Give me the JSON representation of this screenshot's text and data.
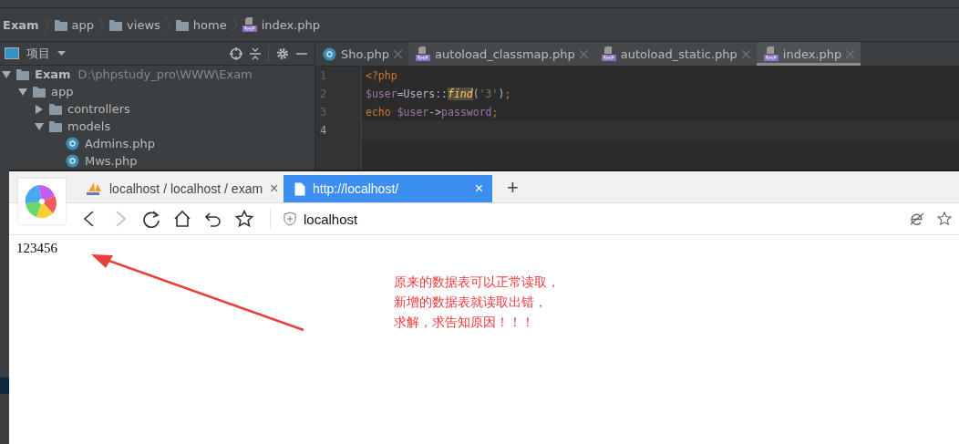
{
  "breadcrumb": [
    {
      "label": "Exam",
      "kind": "project"
    },
    {
      "label": "app",
      "kind": "folder"
    },
    {
      "label": "views",
      "kind": "folder"
    },
    {
      "label": "home",
      "kind": "folder"
    },
    {
      "label": "index.php",
      "kind": "php"
    }
  ],
  "project_panel": {
    "title": "项目",
    "tree": [
      {
        "label": "Exam",
        "kind": "folder",
        "path": "D:\\phpstudy_pro\\WWW\\Exam",
        "expanded": true,
        "children": [
          {
            "label": "app",
            "kind": "folder",
            "expanded": true,
            "children": [
              {
                "label": "controllers",
                "kind": "folder",
                "expanded": false
              },
              {
                "label": "models",
                "kind": "folder",
                "expanded": true,
                "children": [
                  {
                    "label": "Admins.php",
                    "kind": "class"
                  },
                  {
                    "label": "Mws.php",
                    "kind": "class"
                  }
                ]
              }
            ]
          }
        ]
      }
    ]
  },
  "editor_tabs": [
    {
      "label": "Sho.php",
      "kind": "class",
      "selected": false
    },
    {
      "label": "autoload_classmap.php",
      "kind": "php",
      "selected": false
    },
    {
      "label": "autoload_static.php",
      "kind": "php",
      "selected": false
    },
    {
      "label": "index.php",
      "kind": "php",
      "selected": true
    }
  ],
  "code_lines": [
    {
      "number": "1",
      "current": false,
      "tokens": [
        {
          "text": "<?php",
          "kind": "keyword"
        }
      ]
    },
    {
      "number": "2",
      "current": false,
      "tokens": [
        {
          "text": "$user",
          "kind": "variable"
        },
        {
          "text": "=Users::",
          "kind": "plain"
        },
        {
          "text": "find",
          "kind": "function"
        },
        {
          "text": "(",
          "kind": "plain"
        },
        {
          "text": "'3'",
          "kind": "string"
        },
        {
          "text": ")",
          "kind": "plain"
        },
        {
          "text": ";",
          "kind": "keyword"
        }
      ]
    },
    {
      "number": "3",
      "current": false,
      "tokens": [
        {
          "text": "echo ",
          "kind": "keyword"
        },
        {
          "text": "$user",
          "kind": "variable"
        },
        {
          "text": "->",
          "kind": "plain"
        },
        {
          "text": "password",
          "kind": "variable"
        },
        {
          "text": ";",
          "kind": "keyword"
        }
      ]
    },
    {
      "number": "4",
      "current": true
    }
  ],
  "browser": {
    "tabs": [
      {
        "label": "localhost / localhost / exam",
        "kind": "pma",
        "selected": false,
        "close": "×"
      },
      {
        "label": "http://localhost/",
        "kind": "page",
        "selected": true,
        "close": "×"
      }
    ],
    "new_tab": "+",
    "address": "localhost",
    "page_text": "123456",
    "annotation": [
      "原来的数据表可以正常读取，",
      "新增的数据表就读取出错，",
      "求解，求告知原因！！！"
    ]
  }
}
